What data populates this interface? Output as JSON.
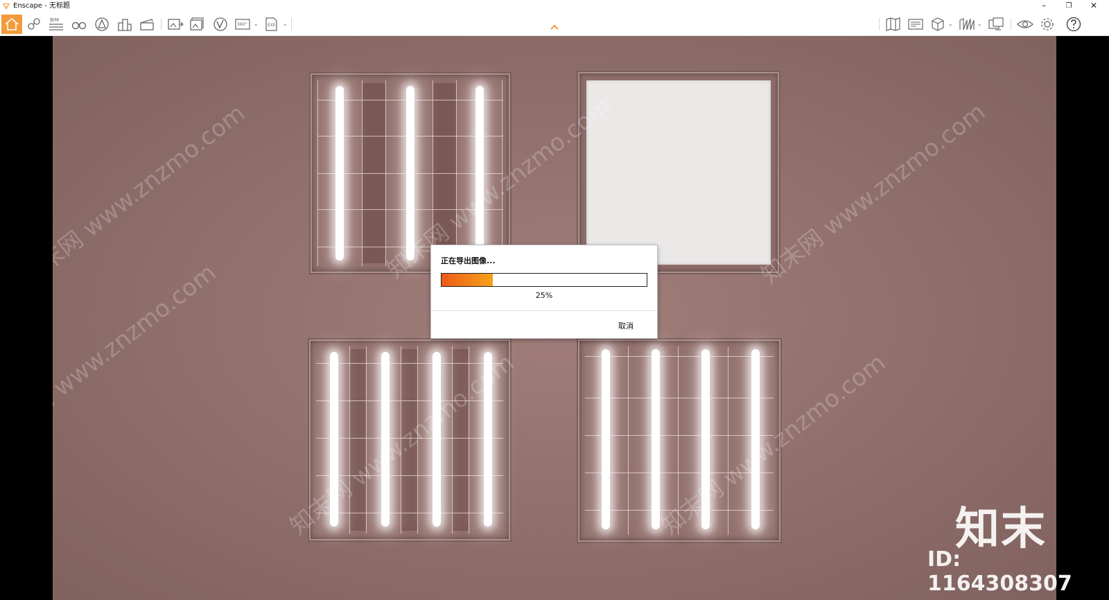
{
  "titlebar": {
    "title": "Enscape - 无标题",
    "buttons": {
      "minimize": "–",
      "restore": "❐",
      "close": "✕"
    }
  },
  "toolbar": {
    "left_tools": [
      "home-icon",
      "location-pin-icon",
      "bim-icon",
      "binoculars-icon",
      "asset-library-icon",
      "buildings-icon",
      "clapperboard-icon",
      "export-screenshot-icon",
      "batch-render-icon",
      "vr-icon",
      "panorama-360-icon",
      "exe-export-icon"
    ],
    "right_tools": [
      "map-icon",
      "collaboration-icon",
      "view-cube-icon",
      "visual-presets-icon",
      "material-editor-icon",
      "eye-icon",
      "settings-icon",
      "help-icon"
    ],
    "bim_label": "BIM",
    "panorama_label": "360°",
    "exe_label": "EXE",
    "accent_color": "#f39a3a"
  },
  "viewport": {
    "background_color": "#9c7773",
    "watermark_text": "知末网 www.znzmo.com",
    "brand_text": "知末",
    "id_text": "ID: 1164308307"
  },
  "dialog": {
    "title": "正在导出图像...",
    "progress_percent": 25,
    "progress_label": "25%",
    "cancel_label": "取消",
    "progress_colors": [
      "#ec5a18",
      "#f7a21a"
    ]
  }
}
